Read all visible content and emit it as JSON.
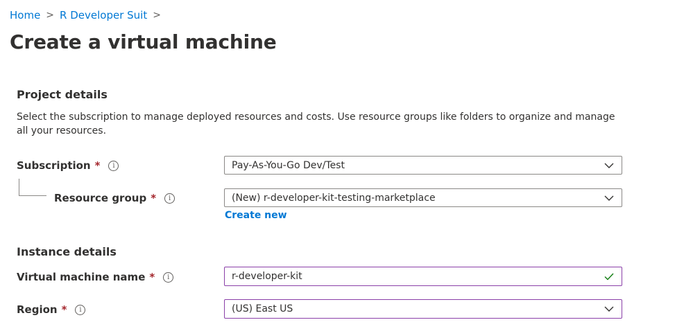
{
  "breadcrumb": {
    "items": [
      {
        "label": "Home"
      },
      {
        "label": "R Developer Suit"
      }
    ],
    "separator": ">"
  },
  "page": {
    "title": "Create a virtual machine"
  },
  "project_details": {
    "heading": "Project details",
    "description": "Select the subscription to manage deployed resources and costs. Use resource groups like folders to organize and manage all your resources.",
    "subscription": {
      "label": "Subscription",
      "required_mark": "*",
      "info_icon": "info-icon",
      "value": "Pay-As-You-Go Dev/Test"
    },
    "resource_group": {
      "label": "Resource group",
      "required_mark": "*",
      "info_icon": "info-icon",
      "value": "(New) r-developer-kit-testing-marketplace",
      "create_new_label": "Create new"
    }
  },
  "instance_details": {
    "heading": "Instance details",
    "vm_name": {
      "label": "Virtual machine name",
      "required_mark": "*",
      "info_icon": "info-icon",
      "value": "r-developer-kit",
      "valid_icon": "checkmark-icon"
    },
    "region": {
      "label": "Region",
      "required_mark": "*",
      "info_icon": "info-icon",
      "value": "(US) East US"
    }
  },
  "colors": {
    "link": "#0078d4",
    "required": "#a4262c",
    "focus_border": "#8a3fa8",
    "valid_check": "#107c10",
    "text": "#323130",
    "border": "#8a8886"
  }
}
